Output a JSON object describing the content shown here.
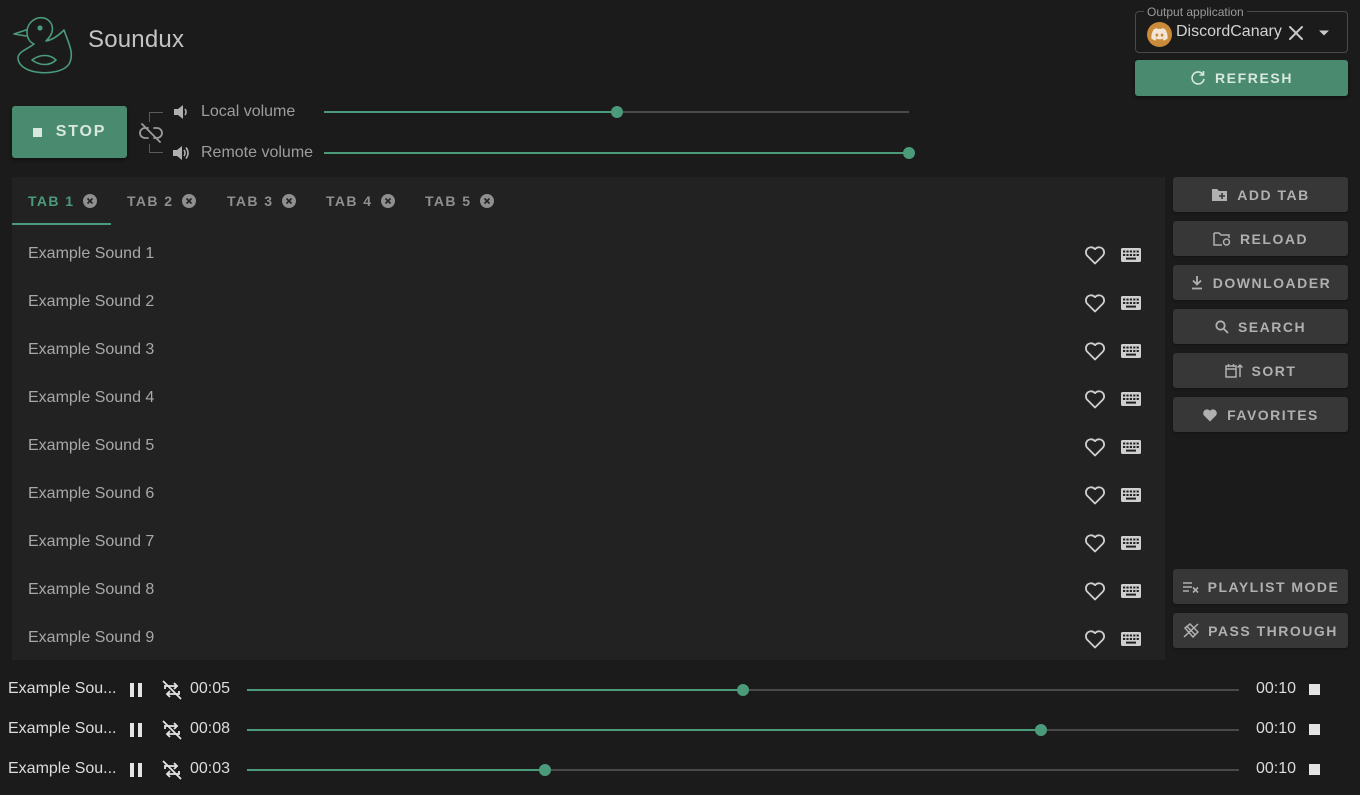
{
  "app": {
    "title": "Soundux"
  },
  "output": {
    "legend": "Output application",
    "value": "DiscordCanary"
  },
  "buttons": {
    "refresh": "REFRESH",
    "stop": "STOP"
  },
  "volume": {
    "local_label": "Local volume",
    "local_level": 0.5,
    "remote_label": "Remote volume",
    "remote_level": 1.0
  },
  "tabs": [
    {
      "label": "TAB 1",
      "active": true
    },
    {
      "label": "TAB 2",
      "active": false
    },
    {
      "label": "TAB 3",
      "active": false
    },
    {
      "label": "TAB 4",
      "active": false
    },
    {
      "label": "TAB 5",
      "active": false
    }
  ],
  "sounds": [
    "Example Sound 1",
    "Example Sound 2",
    "Example Sound 3",
    "Example Sound 4",
    "Example Sound 5",
    "Example Sound 6",
    "Example Sound 7",
    "Example Sound 8",
    "Example Sound 9"
  ],
  "sidebar": {
    "add_tab": "ADD TAB",
    "reload": "RELOAD",
    "downloader": "DOWNLOADER",
    "search": "SEARCH",
    "sort": "SORT",
    "favorites": "FAVORITES",
    "playlist_mode": "PLAYLIST MODE",
    "pass_through": "PASS THROUGH"
  },
  "playing": [
    {
      "name": "Example Sou...",
      "current": "00:05",
      "total": "00:10",
      "progress": 0.5
    },
    {
      "name": "Example Sou...",
      "current": "00:08",
      "total": "00:10",
      "progress": 0.8
    },
    {
      "name": "Example Sou...",
      "current": "00:03",
      "total": "00:10",
      "progress": 0.3
    }
  ],
  "colors": {
    "accent": "#4b9a7a",
    "button_green": "#4a8a6e",
    "background": "#1b1b1b",
    "panel": "#222222",
    "secondary_button": "#373737"
  },
  "icons": {
    "logo": "duck-logo",
    "output_avatar": "discord-icon",
    "refresh": "refresh-icon",
    "link": "link-off-icon",
    "volume": "volume-icon",
    "tab_close": "close-circle-icon",
    "favorite": "heart-outline-icon",
    "hotkey": "keyboard-icon",
    "add_tab": "folder-plus-icon",
    "reload": "folder-refresh-icon",
    "downloader": "download-icon",
    "search": "search-icon",
    "sort": "sort-calendar-icon",
    "favorites": "heart-icon",
    "playlist_mode": "playlist-remove-icon",
    "pass_through": "pass-through-icon",
    "pause": "pause-icon",
    "repeat": "repeat-off-icon",
    "stop": "stop-icon"
  }
}
